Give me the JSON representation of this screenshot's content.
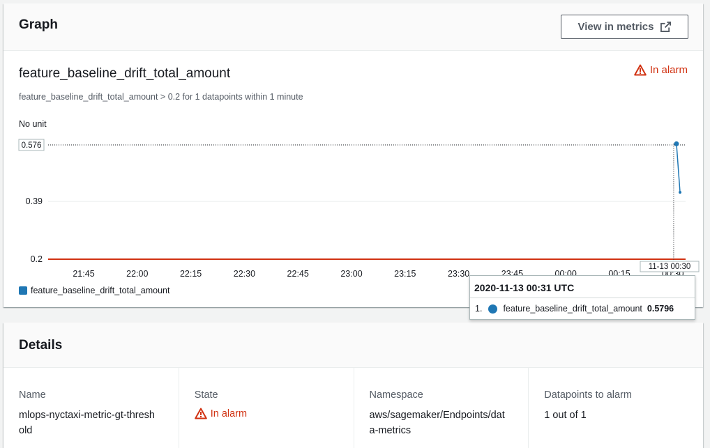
{
  "graph_panel": {
    "title": "Graph",
    "view_button_label": "View in metrics",
    "metric_title": "feature_baseline_drift_total_amount",
    "alarm_status": "In alarm",
    "condition": "feature_baseline_drift_total_amount > 0.2 for 1 datapoints within 1 minute",
    "unit_label": "No unit",
    "legend_label": "feature_baseline_drift_total_amount",
    "colors": {
      "series": "#1f77b4",
      "threshold": "#d13212",
      "alarm": "#d13212"
    }
  },
  "chart_data": {
    "type": "line",
    "y_ticks": [
      "0.2",
      "0.39",
      "0.576"
    ],
    "ylim": [
      0.2,
      0.576
    ],
    "x_ticks": [
      "21:45",
      "22:00",
      "22:15",
      "22:30",
      "22:45",
      "23:00",
      "23:15",
      "23:30",
      "23:45",
      "00:00",
      "00:15",
      "00:30"
    ],
    "x_highlight_label": "11-13 00:30",
    "threshold": 0.2,
    "series": [
      {
        "values": [
          {
            "x": "00:31",
            "y": 0.5796
          },
          {
            "x": "00:32",
            "y": 0.42
          }
        ]
      }
    ],
    "legend": "bottom-left"
  },
  "tooltip": {
    "time": "2020-11-13 00:31 UTC",
    "index": "1.",
    "series_name": "feature_baseline_drift_total_amount",
    "value": "0.5796"
  },
  "details_panel": {
    "title": "Details",
    "columns": [
      {
        "label": "Name",
        "value": "mlops-nyctaxi-metric-gt-threshold"
      },
      {
        "label": "State",
        "value": "In alarm"
      },
      {
        "label": "Namespace",
        "value": "aws/sagemaker/Endpoints/data-metrics"
      },
      {
        "label": "Datapoints to alarm",
        "value": "1 out of 1"
      }
    ]
  }
}
